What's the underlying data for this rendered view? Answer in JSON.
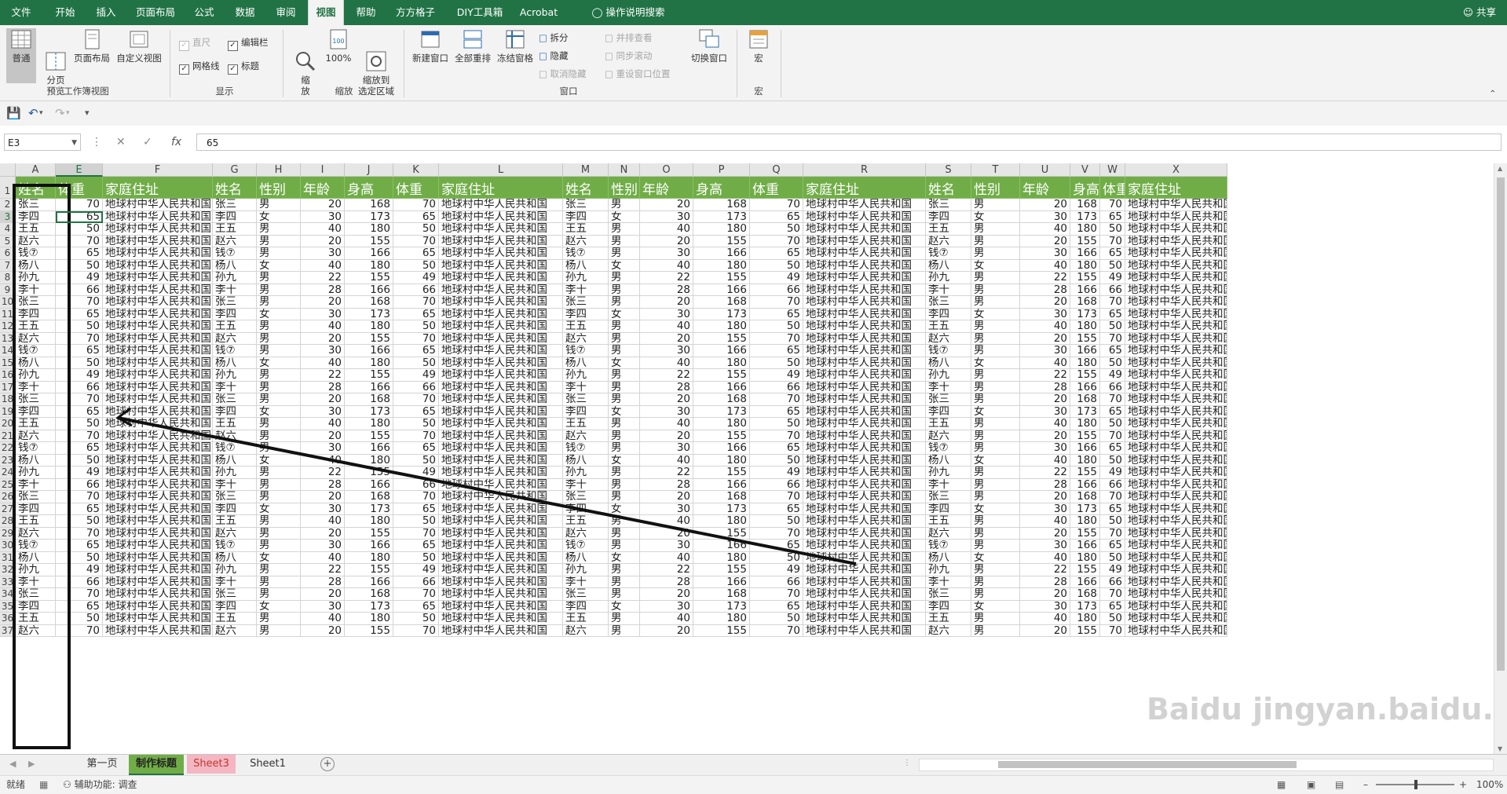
{
  "ribbon_tabs": [
    "文件",
    "开始",
    "插入",
    "页面布局",
    "公式",
    "数据",
    "审阅",
    "视图",
    "帮助",
    "方方格子",
    "DIY工具箱",
    "Acrobat"
  ],
  "active_tab": "视图",
  "tell_me": "操作说明搜索",
  "share": "共享",
  "groups": {
    "workbook_views": {
      "label": "工作簿视图",
      "normal": "普通",
      "page_break": "分页\n预览",
      "page_layout": "页面布局",
      "custom": "自定义视图"
    },
    "show": {
      "label": "显示",
      "ruler": "直尺",
      "formula_bar": "编辑栏",
      "gridlines": "网格线",
      "headings": "标题"
    },
    "zoom": {
      "label": "缩放",
      "zoom": "缩\n放",
      "hundred": "100%",
      "zoom_to_selection": "缩放到\n选定区域"
    },
    "window": {
      "label": "窗口",
      "new_window": "新建窗口",
      "arrange_all": "全部重排",
      "freeze_panes": "冻结窗格",
      "split": "拆分",
      "hide": "隐藏",
      "unhide": "取消隐藏",
      "side_by_side": "并排查看",
      "sync_scroll": "同步滚动",
      "reset_position": "重设窗口位置",
      "switch_windows": "切换窗口"
    },
    "macros": {
      "label": "宏",
      "macros": "宏"
    }
  },
  "name_box": "E3",
  "formula_value": "65",
  "columns": [
    "A",
    "E",
    "F",
    "G",
    "H",
    "I",
    "J",
    "K",
    "L",
    "M",
    "N",
    "O",
    "P",
    "Q",
    "R",
    "S",
    "T",
    "U",
    "V",
    "W",
    "X"
  ],
  "header_labels": [
    "姓名",
    "体重",
    "家庭住址",
    "姓名",
    "性别",
    "年龄",
    "身高",
    "体重",
    "家庭住址",
    "姓名",
    "性别",
    "年龄",
    "身高",
    "体重",
    "家庭住址",
    "姓名",
    "性别",
    "年龄",
    "身高",
    "体重",
    "家庭住址"
  ],
  "records": [
    [
      "张三",
      "男",
      20,
      168,
      70
    ],
    [
      "李四",
      "女",
      30,
      173,
      65
    ],
    [
      "王五",
      "男",
      40,
      180,
      50
    ],
    [
      "赵六",
      "男",
      20,
      155,
      70
    ],
    [
      "钱⑦",
      "男",
      30,
      166,
      65
    ],
    [
      "杨八",
      "女",
      40,
      180,
      50
    ],
    [
      "孙九",
      "男",
      22,
      155,
      49
    ],
    [
      "李十",
      "男",
      28,
      166,
      66
    ]
  ],
  "address": "地球村中华人民共和国",
  "visible_rows": 37,
  "sheet_tabs": [
    "第一页",
    "制作标题",
    "Sheet3",
    "Sheet1"
  ],
  "active_sheet": "制作标题",
  "status": {
    "ready": "就绪",
    "accessibility": "辅助功能: 调查",
    "zoom": "100%"
  },
  "watermark": "Baidu jingyan.baidu.com"
}
